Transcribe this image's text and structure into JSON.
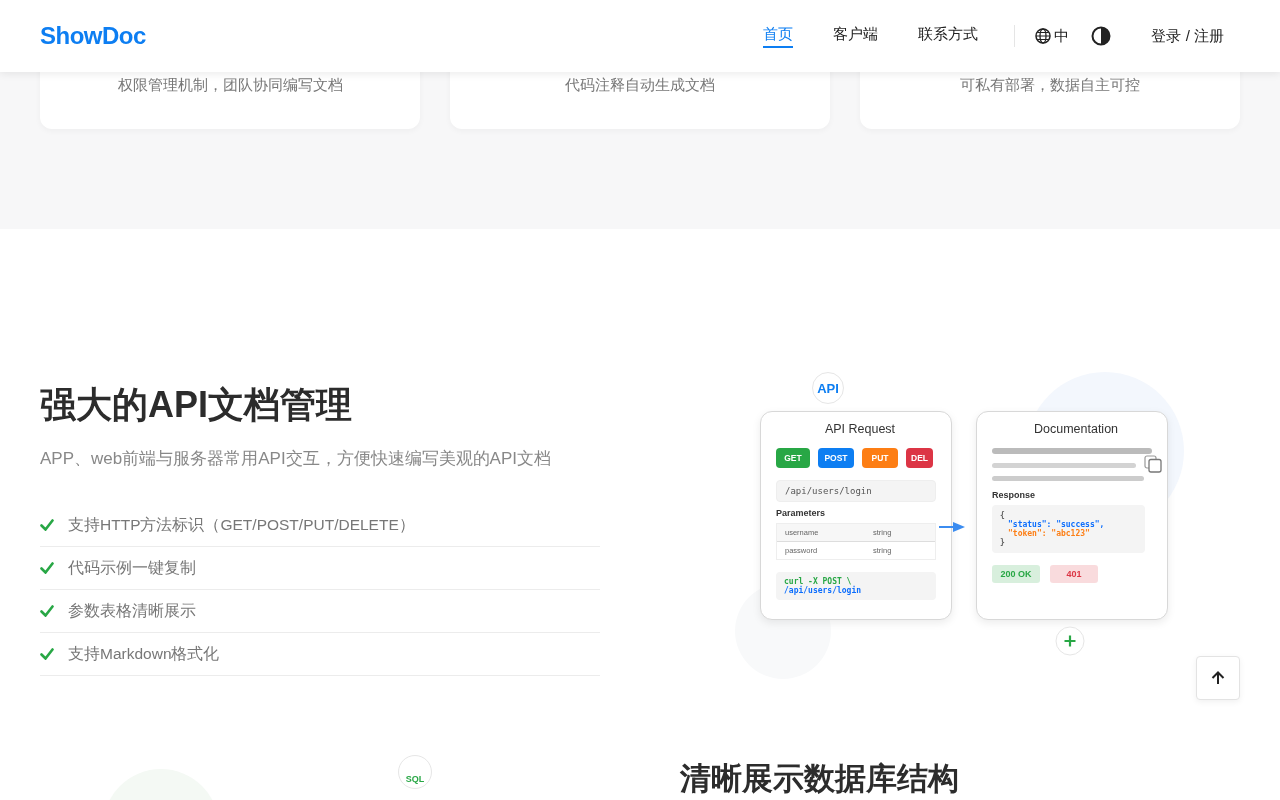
{
  "header": {
    "logo": "ShowDoc",
    "nav": [
      {
        "label": "首页",
        "selected": true
      },
      {
        "label": "客户端",
        "selected": false
      },
      {
        "label": "联系方式",
        "selected": false
      }
    ],
    "language": "中",
    "login": "登录 / 注册"
  },
  "feature_cards": [
    {
      "description": "权限管理机制，团队协同编写文档"
    },
    {
      "description": "代码注释自动生成文档"
    },
    {
      "description": "可私有部署，数据自主可控"
    }
  ],
  "api_section": {
    "title": "强大的API文档管理",
    "subtitle": "APP、web前端与服务器常用API交互，方便快速编写美观的API文档",
    "features": [
      "支持HTTP方法标识（GET/POST/PUT/DELETE）",
      "代码示例一键复制",
      "参数表格清晰展示",
      "支持Markdown格式化"
    ],
    "illustration": {
      "badge": "API",
      "request": {
        "title": "API Request",
        "methods": [
          {
            "label": "GET",
            "color": "#28a745"
          },
          {
            "label": "POST",
            "color": "#0d7ef2"
          },
          {
            "label": "PUT",
            "color": "#fd7e14"
          },
          {
            "label": "DEL",
            "color": "#dc3545"
          }
        ],
        "endpoint": "/api/users/login",
        "params_title": "Parameters",
        "params": [
          {
            "name": "username",
            "type": "string"
          },
          {
            "name": "password",
            "type": "string"
          }
        ],
        "curl": [
          {
            "text": "curl -X POST \\",
            "color": "#28a745"
          },
          {
            "text": "/api/users/login",
            "color": "#0d6efd"
          }
        ]
      },
      "doc": {
        "title": "Documentation",
        "response_title": "Response",
        "json": [
          {
            "text": "{",
            "color": "#666666"
          },
          {
            "text": "\"status\": \"success\",",
            "color": "#0d6efd"
          },
          {
            "text": "\"token\": \"abc123\"",
            "color": "#fd7e14"
          },
          {
            "text": "}",
            "color": "#666666"
          }
        ],
        "statuses": [
          {
            "label": "200 OK",
            "color": "#28a745"
          },
          {
            "label": "401",
            "color": "#dc3545"
          }
        ]
      }
    }
  },
  "db_section": {
    "title": "清晰展示数据库结构",
    "badge": "SQL"
  }
}
